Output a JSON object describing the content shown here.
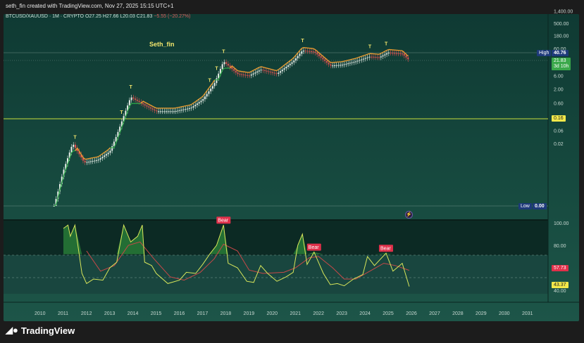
{
  "header": {
    "credit": "seth_fin created with TradingView.com, Nov 27, 2025 15:15 UTC+1"
  },
  "legend": {
    "symbol": "BTCUSD/XAUUSD · 1M · CRYPTO",
    "open": "O27.25",
    "high": "H27.66",
    "low": "L20.03",
    "close": "C21.83",
    "change": "−5.55 (−20.27%)"
  },
  "annotation": "Seth_fin",
  "price_axis": {
    "ticks": [
      "1,400.00",
      "500.00",
      "180.00",
      "60.00",
      "6.00",
      "2.00",
      "0.60",
      "0.06",
      "0.02"
    ],
    "high_label": "High",
    "high_value": "40.76",
    "last_price": "21.83",
    "countdown": "3d 10h",
    "level": "0.16",
    "low_label": "Low",
    "low_value": "0.00"
  },
  "indicator_axis": {
    "ticks": [
      "100.00",
      "80.00",
      "60.00",
      "40.00"
    ],
    "ma_value": "57.73",
    "value": "43.37"
  },
  "time_axis": [
    "2010",
    "2011",
    "2012",
    "2013",
    "2014",
    "2015",
    "2016",
    "2017",
    "2018",
    "2019",
    "2020",
    "2021",
    "2022",
    "2023",
    "2024",
    "2025",
    "2026",
    "2027",
    "2028",
    "2029",
    "2030",
    "2031"
  ],
  "bear_label": "Bear",
  "top_label": "T",
  "footer": {
    "brand": "TradingView"
  },
  "colors": {
    "up": "#e8efe9",
    "down": "#e05050",
    "trail": "#2fa84a",
    "flat": "#f0a030",
    "osc": "#d8e65a",
    "osc_ma": "#c84848",
    "level": "#c8dc3c",
    "bear": "#e0304a"
  },
  "chart_data": [
    {
      "type": "candlestick",
      "scale": "log",
      "price": [
        [
          2010.6,
          0.0001
        ],
        [
          2011.0,
          0.002
        ],
        [
          2011.4,
          0.02
        ],
        [
          2011.9,
          0.004
        ],
        [
          2012.5,
          0.005
        ],
        [
          2013.0,
          0.01
        ],
        [
          2013.3,
          0.04
        ],
        [
          2013.9,
          1.0
        ],
        [
          2014.5,
          0.5
        ],
        [
          2015.0,
          0.3
        ],
        [
          2015.8,
          0.3
        ],
        [
          2016.5,
          0.4
        ],
        [
          2017.0,
          0.8
        ],
        [
          2017.5,
          3
        ],
        [
          2017.9,
          20
        ],
        [
          2018.5,
          7
        ],
        [
          2019.0,
          6
        ],
        [
          2019.5,
          10
        ],
        [
          2020.2,
          7
        ],
        [
          2020.9,
          20
        ],
        [
          2021.3,
          50
        ],
        [
          2021.8,
          45
        ],
        [
          2022.5,
          14
        ],
        [
          2023.0,
          15
        ],
        [
          2023.6,
          20
        ],
        [
          2024.2,
          30
        ],
        [
          2024.6,
          28
        ],
        [
          2025.0,
          42
        ],
        [
          2025.6,
          38
        ],
        [
          2025.9,
          21.83
        ]
      ],
      "tops": [
        2011.5,
        2013.5,
        2013.9,
        2017.3,
        2017.6,
        2017.9,
        2021.3,
        2024.2,
        2024.9
      ],
      "level": 0.16
    },
    {
      "type": "line",
      "ylim": [
        40,
        100
      ],
      "series": [
        {
          "values": [
            [
              2011.0,
              95
            ],
            [
              2011.2,
              98
            ],
            [
              2011.3,
              88
            ],
            [
              2011.5,
              98
            ],
            [
              2011.8,
              55
            ],
            [
              2012.0,
              46
            ],
            [
              2012.3,
              50
            ],
            [
              2012.7,
              49
            ],
            [
              2013.0,
              60
            ],
            [
              2013.3,
              65
            ],
            [
              2013.6,
              98
            ],
            [
              2013.9,
              83
            ],
            [
              2014.2,
              88
            ],
            [
              2014.4,
              98
            ],
            [
              2014.5,
              65
            ],
            [
              2014.8,
              62
            ],
            [
              2015.0,
              55
            ],
            [
              2015.5,
              46
            ],
            [
              2016.0,
              49
            ],
            [
              2016.3,
              56
            ],
            [
              2016.7,
              55
            ],
            [
              2017.0,
              63
            ],
            [
              2017.3,
              72
            ],
            [
              2017.6,
              80
            ],
            [
              2017.9,
              98
            ],
            [
              2018.1,
              64
            ],
            [
              2018.5,
              60
            ],
            [
              2018.9,
              48
            ],
            [
              2019.2,
              47
            ],
            [
              2019.5,
              62
            ],
            [
              2019.8,
              55
            ],
            [
              2020.2,
              48
            ],
            [
              2020.6,
              52
            ],
            [
              2020.9,
              56
            ],
            [
              2021.1,
              80
            ],
            [
              2021.3,
              90
            ],
            [
              2021.5,
              63
            ],
            [
              2021.8,
              74
            ],
            [
              2022.2,
              55
            ],
            [
              2022.5,
              45
            ],
            [
              2022.8,
              46
            ],
            [
              2023.1,
              44
            ],
            [
              2023.5,
              50
            ],
            [
              2023.9,
              54
            ],
            [
              2024.1,
              70
            ],
            [
              2024.4,
              62
            ],
            [
              2024.9,
              73
            ],
            [
              2025.2,
              57
            ],
            [
              2025.6,
              64
            ],
            [
              2025.9,
              43.37
            ]
          ]
        },
        {
          "values": [
            [
              2012.0,
              75
            ],
            [
              2012.6,
              57
            ],
            [
              2013.2,
              62
            ],
            [
              2013.8,
              80
            ],
            [
              2014.3,
              83
            ],
            [
              2014.9,
              68
            ],
            [
              2015.6,
              52
            ],
            [
              2016.2,
              49
            ],
            [
              2016.9,
              56
            ],
            [
              2017.5,
              68
            ],
            [
              2017.9,
              81
            ],
            [
              2018.5,
              75
            ],
            [
              2019.0,
              58
            ],
            [
              2019.6,
              55
            ],
            [
              2020.5,
              56
            ],
            [
              2021.0,
              60
            ],
            [
              2021.6,
              69
            ],
            [
              2022.0,
              70
            ],
            [
              2022.6,
              60
            ],
            [
              2023.1,
              50
            ],
            [
              2023.6,
              50
            ],
            [
              2024.2,
              57
            ],
            [
              2024.8,
              64
            ],
            [
              2025.3,
              62
            ],
            [
              2025.9,
              57.73
            ]
          ]
        }
      ]
    }
  ]
}
